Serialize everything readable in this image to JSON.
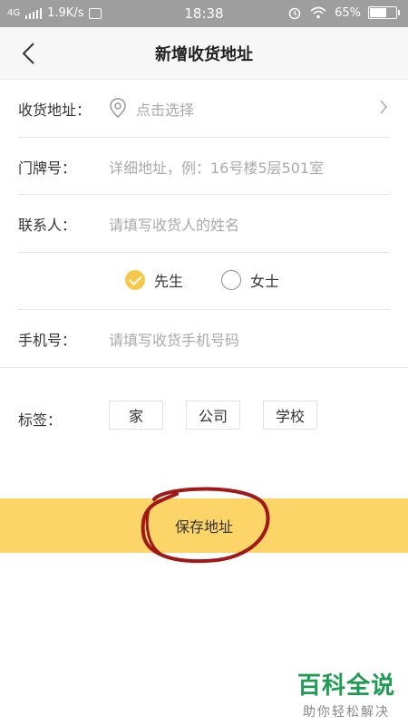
{
  "status_bar": {
    "network": "4G",
    "speed": "1.9K/s",
    "time": "18:38",
    "battery": "65%",
    "battery_level": 0.65
  },
  "header": {
    "title": "新增收货地址"
  },
  "form": {
    "address": {
      "label": "收货地址：",
      "placeholder": "点击选择"
    },
    "door": {
      "label": "门牌号：",
      "placeholder": "详细地址，例：16号楼5层501室"
    },
    "contact": {
      "label": "联系人：",
      "placeholder": "请填写收货人的姓名"
    },
    "gender": {
      "options": [
        {
          "label": "先生",
          "selected": true
        },
        {
          "label": "女士",
          "selected": false
        }
      ]
    },
    "phone": {
      "label": "手机号：",
      "placeholder": "请填写收货手机号码"
    }
  },
  "tags": {
    "label": "标签：",
    "items": [
      "家",
      "公司",
      "学校"
    ]
  },
  "save_button": {
    "label": "保存地址"
  },
  "watermark": {
    "title": "百科全说",
    "subtitle": "助你轻松解决"
  },
  "colors": {
    "accent": "#fcd468",
    "check": "#f8c848",
    "scribble": "#a01818",
    "watermark": "#1f9b54"
  }
}
